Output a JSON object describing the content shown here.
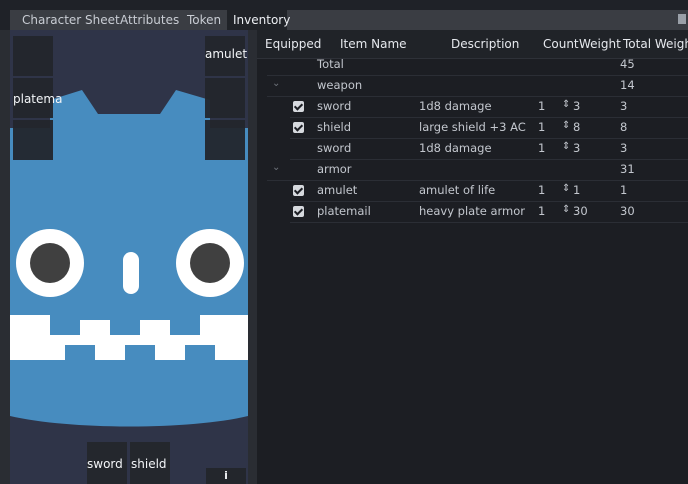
{
  "tabs": [
    {
      "label": "Character Sheet"
    },
    {
      "label": "Attributes"
    },
    {
      "label": "Token"
    },
    {
      "label": "Inventory"
    }
  ],
  "slots": {
    "amulet": "amulet",
    "platemail": "platema",
    "sword": "sword",
    "shield": "shield",
    "info": "i"
  },
  "table": {
    "headers": [
      "Equipped",
      "Item Name",
      "Description",
      "Count",
      "Weight",
      "Total Weight"
    ],
    "total": {
      "label": "Total",
      "total_weight": "45"
    },
    "groups": [
      {
        "name": "weapon",
        "total_weight": "14",
        "items": [
          {
            "equipped": true,
            "name": "sword",
            "description": "1d8 damage",
            "count": "1",
            "weight": "3",
            "total_weight": "3"
          },
          {
            "equipped": true,
            "name": "shield",
            "description": "large shield +3 AC",
            "count": "1",
            "weight": "8",
            "total_weight": "8"
          },
          {
            "equipped": false,
            "name": "sword",
            "description": "1d8 damage",
            "count": "1",
            "weight": "3",
            "total_weight": "3"
          }
        ]
      },
      {
        "name": "armor",
        "total_weight": "31",
        "items": [
          {
            "equipped": true,
            "name": "amulet",
            "description": "amulet of life",
            "count": "1",
            "weight": "1",
            "total_weight": "1"
          },
          {
            "equipped": true,
            "name": "platemail",
            "description": "heavy plate armor",
            "count": "1",
            "weight": "30",
            "total_weight": "30"
          }
        ]
      }
    ]
  },
  "colors": {
    "godot_blue": "#478cbf",
    "panel": "#2a2d33",
    "background": "#1a1d23"
  }
}
